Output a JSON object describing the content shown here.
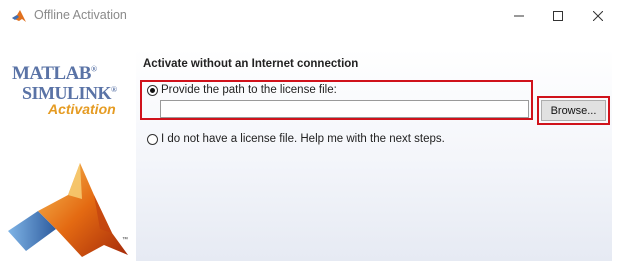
{
  "window": {
    "title": "Offline Activation",
    "icon": "matlab-logo-icon",
    "controls": [
      "minimize-icon",
      "maximize-icon",
      "close-icon"
    ]
  },
  "sidebar": {
    "brand_line1": "MATLAB",
    "brand_line2": "SIMULINK",
    "brand_registered": "®",
    "brand_subtitle": "Activation",
    "trademark": "™"
  },
  "main": {
    "heading": "Activate without an Internet connection",
    "options": [
      {
        "label": "Provide the path to the license file:",
        "selected": true
      },
      {
        "label": "I do not have a license file.  Help me with the next steps.",
        "selected": false
      }
    ],
    "license_path": {
      "value": "",
      "placeholder": ""
    },
    "browse_label": "Browse..."
  },
  "colors": {
    "highlight": "#d0121b",
    "brand_blue": "#5a73a6",
    "brand_orange": "#e59b22"
  }
}
